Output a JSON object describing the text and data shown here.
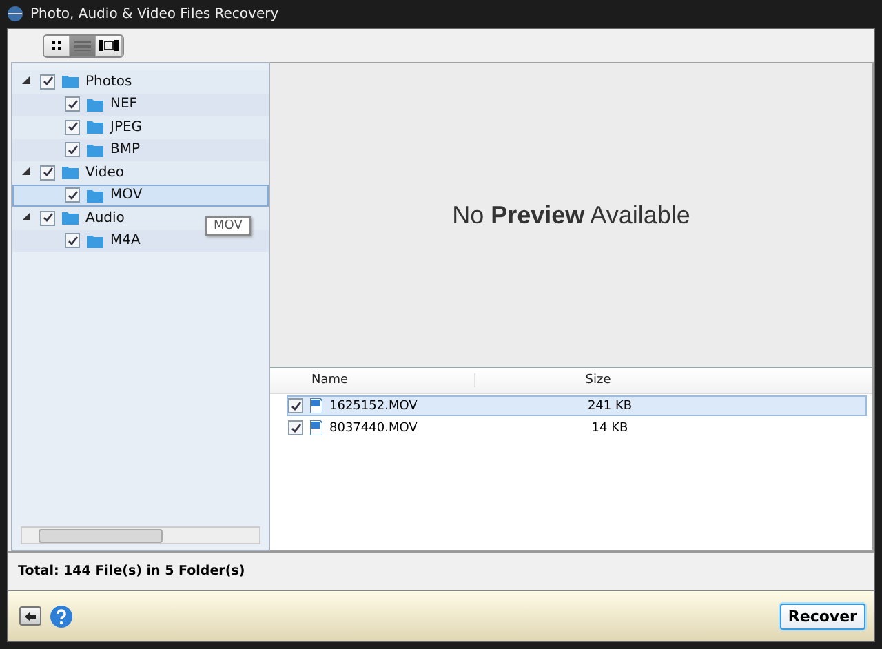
{
  "window": {
    "title": "Photo, Audio & Video Files Recovery"
  },
  "view_buttons": [
    {
      "kind": "thumbnails",
      "selected": false
    },
    {
      "kind": "list",
      "selected": true
    },
    {
      "kind": "filmstrip",
      "selected": false
    }
  ],
  "tree": [
    {
      "label": "Photos",
      "checked": true,
      "expanded": true,
      "selected": false,
      "children": [
        {
          "label": "NEF",
          "checked": true,
          "selected": false
        },
        {
          "label": "JPEG",
          "checked": true,
          "selected": false
        },
        {
          "label": "BMP",
          "checked": true,
          "selected": false
        }
      ]
    },
    {
      "label": "Video",
      "checked": true,
      "expanded": true,
      "selected": false,
      "children": [
        {
          "label": "MOV",
          "checked": true,
          "selected": true
        }
      ]
    },
    {
      "label": "Audio",
      "checked": true,
      "expanded": true,
      "selected": false,
      "children": [
        {
          "label": "M4A",
          "checked": true,
          "selected": false
        }
      ]
    }
  ],
  "tooltip": "MOV",
  "preview": {
    "message": "No **Preview** Available"
  },
  "file_list": {
    "columns": [
      "Name",
      "Size"
    ],
    "rows": [
      {
        "name": "1625152.MOV",
        "size": "241 KB",
        "checked": true,
        "selected": true
      },
      {
        "name": "8037440.MOV",
        "size": "14 KB",
        "checked": true,
        "selected": false
      }
    ]
  },
  "status": "Total: 144 File(s) in 5 Folder(s)",
  "footer": {
    "button": "Recover"
  }
}
